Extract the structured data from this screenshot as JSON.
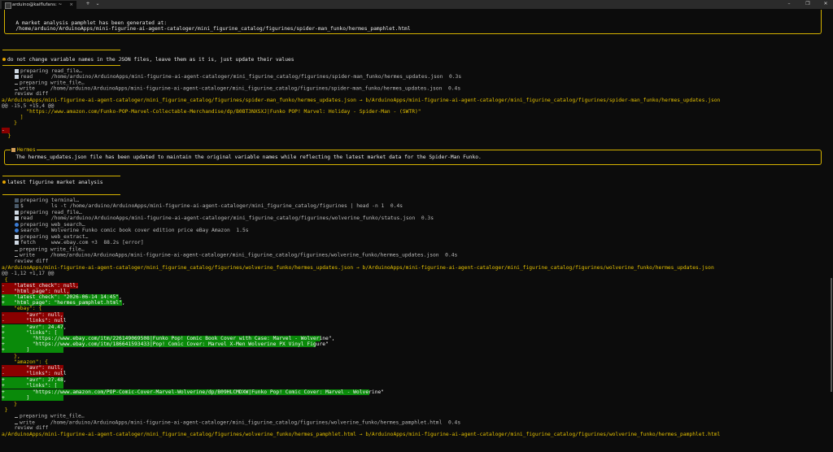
{
  "titlebar": {
    "tab_title": "arduino@kaiflufans: ~",
    "tab_close": "×",
    "new_tab": "+",
    "dropdown": "⌄",
    "min": "–",
    "max": "❐",
    "close": "✕"
  },
  "colors": {
    "accent": "#e5c100",
    "removed": "#8a0000",
    "added": "#0a8a0a",
    "background": "#0c0c0c"
  },
  "lines": {
    "l1": "   A market analysis pamphlet has been generated at:",
    "l2": "   /home/arduino/ArduinoApps/mini-figurine-ai-agent-cataloger/mini_figurine_catalog/figurines/spider-man_funko/hermes_pamphlet.html",
    "l3": "do not change variable names in the JSON files, leave them as it is, just update their values",
    "l4": "preparing read_file…",
    "l5": "read      /home/arduino/ArduinoApps/mini-figurine-ai-agent-cataloger/mini_figurine_catalog/figurines/spider-man_funko/hermes_updates.json  0.3s",
    "l6": "preparing write_file…",
    "l7": "write     /home/arduino/ArduinoApps/mini-figurine-ai-agent-cataloger/mini_figurine_catalog/figurines/spider-man_funko/hermes_updates.json  0.4s",
    "l8": "  review diff",
    "l9": "a/ArduinoApps/mini-figurine-ai-agent-cataloger/mini_figurine_catalog/figurines/spider-man_funko/hermes_updates.json → b/ArduinoApps/mini-figurine-ai-agent-cataloger/mini_figurine_catalog/figurines/spider-man_funko/hermes_updates.json",
    "l10": "@@ -15,5 +15,4 @@",
    "l11": "        \"https://www.amazon.com/Funko-POP-Marvel-Collectable-Merchandise/dp/B0BT3NXSXJ|Funko POP! Marvel: Holiday - Spider-Man - (SWTR)\"",
    "l12": "      ]",
    "l13": "    }",
    "l14": "-",
    "l15": "  }",
    "l16_title": "Hermes",
    "l17": "   The hermes_updates.json file has been updated to maintain the original variable names while reflecting the latest market data for the Spider-Man Funko.",
    "l18": "latest figurine market analysis",
    "l19": "preparing terminal…",
    "l20": "$         ls -t /home/arduino/ArduinoApps/mini-figurine-ai-agent-cataloger/mini_figurine_catalog/figurines | head -n 1  0.4s",
    "l21": "preparing read_file…",
    "l22": "read      /home/arduino/ArduinoApps/mini-figurine-ai-agent-cataloger/mini_figurine_catalog/figurines/wolverine_funko/status.json  0.3s",
    "l23": "preparing web_search…",
    "l24": "search    Wolverine Funko comic book cover edition price eBay Amazon  1.5s",
    "l25": "preparing web_extract…",
    "l26": "fetch     www.ebay.com +3  88.2s [error]",
    "l27": "preparing write_file…",
    "l28": "write     /home/arduino/ArduinoApps/mini-figurine-ai-agent-cataloger/mini_figurine_catalog/figurines/wolverine_funko/hermes_updates.json  0.4s",
    "l29": "  review diff",
    "l30": "a/ArduinoApps/mini-figurine-ai-agent-cataloger/mini_figurine_catalog/figurines/wolverine_funko/hermes_updates.json → b/ArduinoApps/mini-figurine-ai-agent-cataloger/mini_figurine_catalog/figurines/wolverine_funko/hermes_updates.json",
    "l31": "@@ -1,12 +1,17 @@",
    "l32": " {",
    "l33": "-   \"latest_check\": null,",
    "l34": "-   \"html_page\": null,",
    "l35": "+   \"latest_check\": \"2026-06-14 14:45\",",
    "l36": "+   \"html_page\": \"hermes_pamphlet.html\",",
    "l37": "    \"ebay\": {",
    "l38": "-       \"avr\": null,",
    "l39": "-       \"links\": null",
    "l40": "+       \"avr\": 24.47,",
    "l41": "+       \"links\": [",
    "l42": "+         \"https://www.ebay.com/itm/226149069508|Funko Pop! Comic Book Cover with Case: Marvel - Wolverine\",",
    "l43": "+         \"https://www.ebay.com/itm/186641593433|Pop! Comic Cover: Marvel X-Men Wolverine PX Vinyl Figure\"",
    "l44": "+       ]",
    "l45": "    },",
    "l46": "    \"amazon\": {",
    "l47": "-       \"avr\": null,",
    "l48": "-       \"links\": null",
    "l49": "+       \"avr\": 27.48,",
    "l50": "+       \"links\": [",
    "l51": "+         \"https://www.amazon.com/POP-Comic-Cover-Marvel-Wolverine/dp/B09HLCMDXW|Funko Pop! Comic Cover: Marvel - Wolverine\"",
    "l52": "+       ]",
    "l53": "    }",
    "l54": " }",
    "l55": "preparing write_file…",
    "l56": "write     /home/arduino/ArduinoApps/mini-figurine-ai-agent-cataloger/mini_figurine_catalog/figurines/wolverine_funko/hermes_pamphlet.html  0.4s",
    "l57": "  review diff",
    "l58": "a/ArduinoApps/mini-figurine-ai-agent-cataloger/mini_figurine_catalog/figurines/wolverine_funko/hermes_pamphlet.html → b/ArduinoApps/mini-figurine-ai-agent-cataloger/mini_figurine_catalog/figurines/wolverine_funko/hermes_pamphlet.html"
  }
}
